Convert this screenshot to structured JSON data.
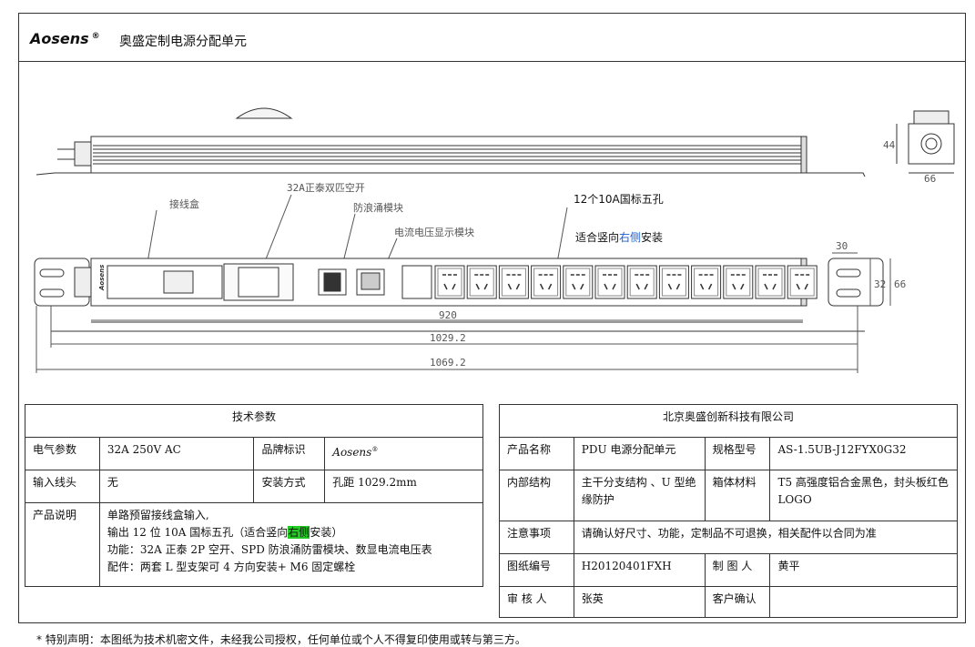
{
  "header": {
    "brand": "Aosens",
    "reg": "®",
    "title": "奥盛定制电源分配单元"
  },
  "drawing": {
    "labels": {
      "junction_box": "接线盒",
      "breaker": "32A正泰双匹空开",
      "spd": "防浪涌模块",
      "meter": "电流电压显示模块",
      "sockets": "12个10A国标五孔",
      "mount_pre": "适合竖向",
      "mount_hl": "右侧",
      "mount_post": "安装",
      "brand_small": "Aosens"
    },
    "dims": {
      "d920": "920",
      "d1029": "1029.2",
      "d1069": "1069.2",
      "d30": "30",
      "d32": "32",
      "d66": "66",
      "d44": "44",
      "d66b": "66"
    },
    "socket_count": 12
  },
  "tech": {
    "title": "技术参数",
    "rows": [
      {
        "k1": "电气参数",
        "v1": "32A 250V AC",
        "k2": "品牌标识",
        "v2": "Aosens"
      },
      {
        "k1": "输入线头",
        "v1": "无",
        "k2": "安装方式",
        "v2": "孔距 1029.2mm"
      }
    ],
    "desc_label": "产品说明",
    "desc": {
      "l1": "单路预留接线盒输入,",
      "l2_pre": "输出 12 位 10A 国标五孔（适合竖向",
      "l2_hl": "右侧",
      "l2_post": "安装）",
      "l3": "功能：32A 正泰 2P 空开、SPD 防浪涌防雷模块、数显电流电压表",
      "l4": "配件：两套 L 型支架可 4 方向安装+ M6 固定螺栓"
    }
  },
  "company": {
    "title": "北京奥盛创新科技有限公司",
    "name_label": "产品名称",
    "name": "PDU 电源分配单元",
    "model_label": "规格型号",
    "model": "AS-1.5UB-J12FYX0G32",
    "struct_label": "内部结构",
    "struct": "主干分支结构 、U 型绝缘防护",
    "material_label": "箱体材料",
    "material": "T5 高强度铝合金黑色，封头板红色 LOGO",
    "note_label": "注意事项",
    "note": "请确认好尺寸、功能，定制品不可退换，相关配件以合同为准",
    "drawing_no_label": "图纸编号",
    "drawing_no": "H20120401FXH",
    "drafter_label": "制 图 人",
    "drafter": "黄平",
    "reviewer_label": "审 核 人",
    "reviewer": "张英",
    "customer_label": "客户确认",
    "customer": ""
  },
  "footer": "* 特别声明：本图纸为技术机密文件，未经我公司授权，任何单位或个人不得复印使用或转与第三方。"
}
